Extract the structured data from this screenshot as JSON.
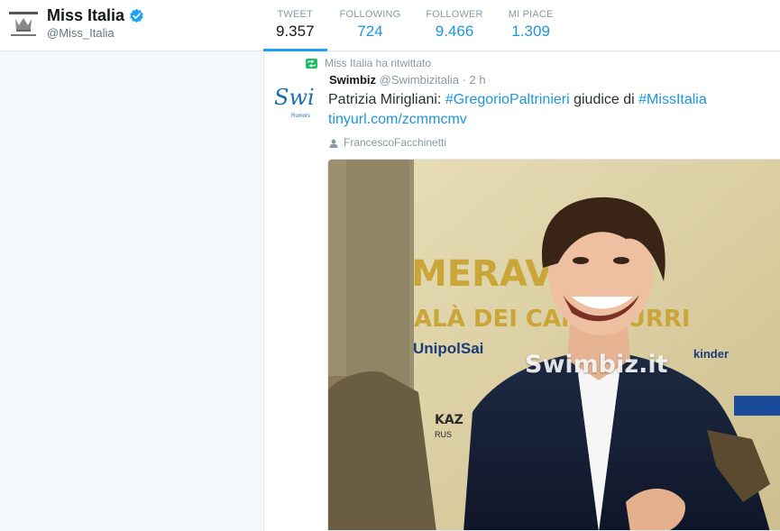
{
  "profile": {
    "name": "Miss Italia",
    "handle": "@Miss_Italia",
    "avatar_text": "MISS ITALIA"
  },
  "stats": [
    {
      "label": "TWEET",
      "value": "9.357",
      "active": true
    },
    {
      "label": "FOLLOWING",
      "value": "724",
      "active": false
    },
    {
      "label": "FOLLOWER",
      "value": "9.466",
      "active": false
    },
    {
      "label": "MI PIACE",
      "value": "1.309",
      "active": false
    }
  ],
  "tweet": {
    "retweet_context": "Miss Italia ha ritwittato",
    "author_name": "Swimbiz",
    "author_handle": "@Swimbizitalia",
    "separator": " · ",
    "time": "2 h",
    "text_prefix": "Patrizia Mirigliani: ",
    "hashtag1": "#GregorioPaltrinieri",
    "text_middle": " giudice di ",
    "hashtag2": "#MissItalia",
    "link": "tinyurl.com/zcmmcmv",
    "tagged_user": "FrancescoFacchinetti",
    "media": {
      "watermark": "Swimbiz.it",
      "backdrop_line1": "MERAV   SSI",
      "backdrop_line2": "ALÀ DEI CAM     ZZURRI",
      "sponsor1": "UnipolSai",
      "sponsor2": "kinder",
      "sponsor3": "KAZ",
      "sponsor4": "RUS"
    }
  },
  "colors": {
    "link": "#1b95e0",
    "verified": "#1da1f2",
    "retweet": "#17bf63",
    "secondary_text": "#8899a6"
  }
}
